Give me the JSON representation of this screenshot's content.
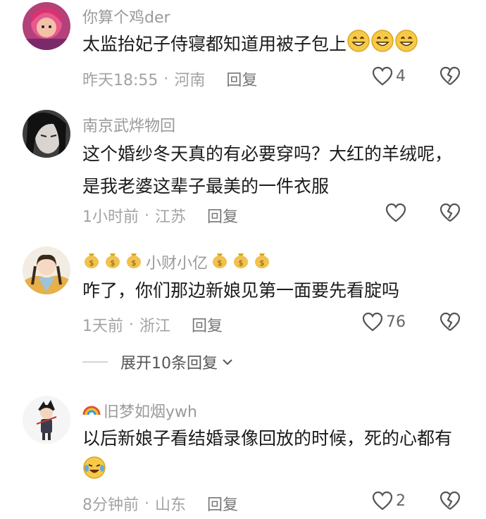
{
  "comments": [
    {
      "username": "你算个鸡der",
      "content": "太监抬妃子侍寝都知道用被子包上",
      "time": "昨天18:55",
      "location": "河南",
      "reply_label": "回复",
      "likes": "4",
      "content_emoji": "grinning-face-icon"
    },
    {
      "username": "南京武烨物回",
      "content": "这个婚纱冬天真的有必要穿吗？大红的羊绒呢，是我老婆这辈子最美的一件衣服",
      "time": "1小时前",
      "location": "江苏",
      "reply_label": "回复",
      "likes": ""
    },
    {
      "username": "小财小亿",
      "username_emoji": "money-bag-icon",
      "content": "咋了，你们那边新娘见第一面要先看腚吗",
      "time": "1天前",
      "location": "浙江",
      "reply_label": "回复",
      "likes": "76"
    },
    {
      "username": "旧梦如烟ywh",
      "username_emoji": "rainbow-icon",
      "content": "以后新娘子看结婚录像回放的时候，死的心都有",
      "content_emoji": "crying-laughing-face-icon",
      "time": "8分钟前",
      "location": "山东",
      "reply_label": "回复",
      "likes": "2"
    }
  ],
  "expand_replies": "展开10条回复",
  "separator": "·",
  "colors": {
    "meta": "#a3a3a3",
    "username": "#9a9a9a",
    "content": "#1b1b1b"
  }
}
